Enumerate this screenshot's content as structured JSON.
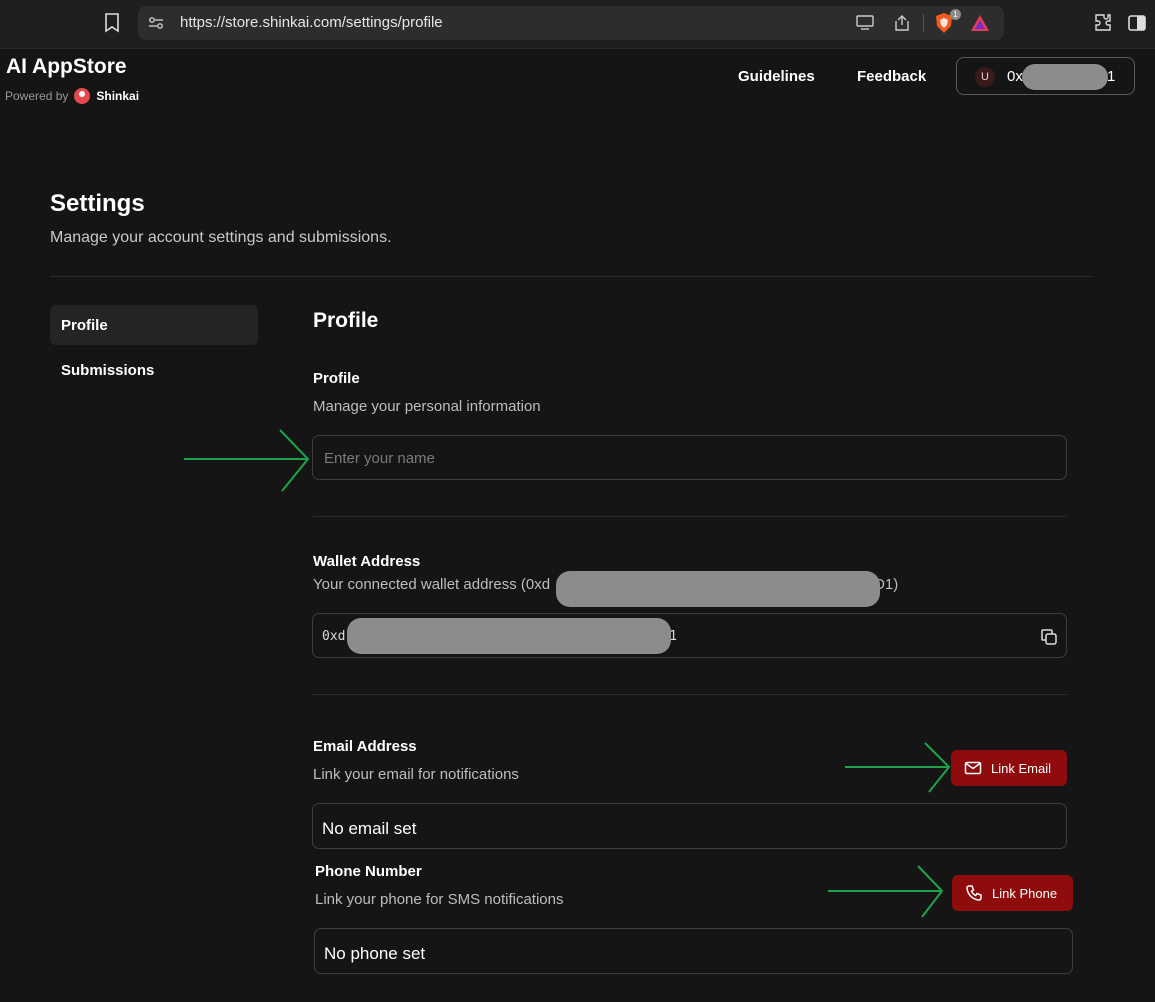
{
  "browser": {
    "url": "https://store.shinkai.com/settings/profile",
    "brave_badge": "1"
  },
  "header": {
    "app_title": "AI AppStore",
    "powered_by": "Powered by",
    "brand": "Shinkai",
    "nav": [
      "Guidelines",
      "Feedback"
    ],
    "wallet": {
      "avatar_letter": "U",
      "prefix": "0x",
      "suffix": "1"
    }
  },
  "settings": {
    "title": "Settings",
    "subtitle": "Manage your account settings and submissions."
  },
  "sidebar": {
    "items": [
      {
        "label": "Profile",
        "active": true
      },
      {
        "label": "Submissions",
        "active": false
      }
    ]
  },
  "profile": {
    "heading": "Profile",
    "section_label": "Profile",
    "section_desc": "Manage your personal information",
    "name_placeholder": "Enter your name",
    "wallet_label": "Wallet Address",
    "wallet_desc_prefix": "Your connected wallet address (0xd",
    "wallet_desc_suffix": "D1)",
    "wallet_value_prefix": "0xd",
    "wallet_value_suffix": "D1",
    "email_label": "Email Address",
    "email_desc": "Link your email for notifications",
    "email_button": "Link Email",
    "email_value": "No email set",
    "phone_label": "Phone Number",
    "phone_desc": "Link your phone for SMS notifications",
    "phone_button": "Link Phone",
    "phone_value": "No phone set"
  },
  "colors": {
    "background": "#151515",
    "accent_red": "#8e0c0c",
    "annotation_arrow": "#1fa34a"
  }
}
